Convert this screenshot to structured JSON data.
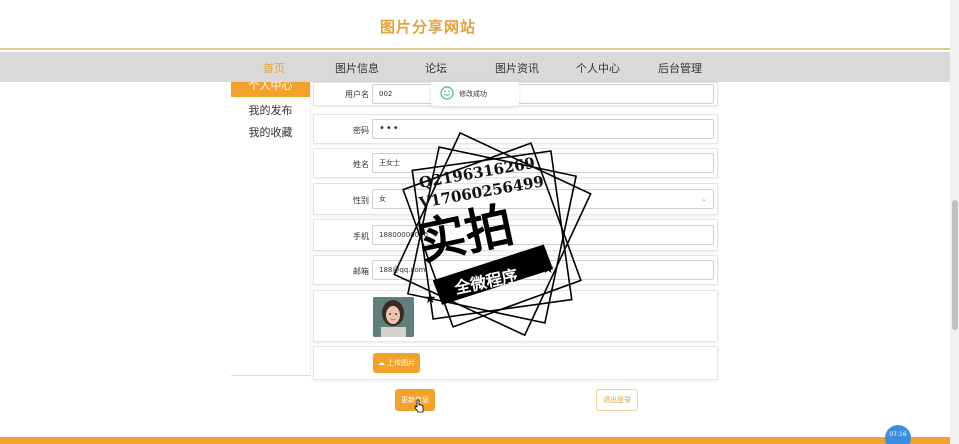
{
  "header": {
    "site_title": "图片分享网站"
  },
  "nav": {
    "items": [
      {
        "label": "首页",
        "active": true
      },
      {
        "label": "图片信息",
        "active": false
      },
      {
        "label": "论坛",
        "active": false
      },
      {
        "label": "图片资讯",
        "active": false
      },
      {
        "label": "个人中心",
        "active": false
      },
      {
        "label": "后台管理",
        "active": false
      }
    ]
  },
  "sidebar": {
    "items": [
      {
        "label": "个人中心",
        "active": true
      },
      {
        "label": "我的发布",
        "active": false
      },
      {
        "label": "我的收藏",
        "active": false
      }
    ]
  },
  "form": {
    "username": {
      "label": "用户名",
      "value": "002"
    },
    "password": {
      "label": "密码",
      "value": "•••"
    },
    "name": {
      "label": "姓名",
      "value": "王女士"
    },
    "gender": {
      "label": "性别",
      "value": "女"
    },
    "phone": {
      "label": "手机",
      "value": "18800000000"
    },
    "email": {
      "label": "邮箱",
      "value": "188@qq.com"
    },
    "upload_button": "上传图片",
    "update_button": "更新信息",
    "logout_button": "退出登录"
  },
  "toast": {
    "message": "修改成功"
  },
  "watermark": {
    "line1": "Q2196316269",
    "line2": "V17060256499",
    "main": "实拍",
    "banner": "全微程序"
  },
  "clock": {
    "time": "07:16"
  },
  "colors": {
    "accent": "#f2a22b",
    "nav_bg": "#d9d9d9",
    "toast_icon": "#3dbf8a",
    "clock_bg": "#3b8de0"
  }
}
